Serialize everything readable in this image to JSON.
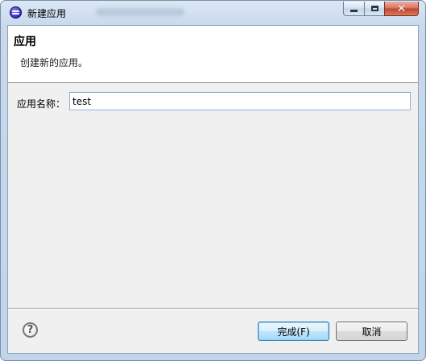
{
  "window": {
    "title": "新建应用",
    "controls": {
      "minimize_icon": "minimize-icon",
      "maximize_icon": "maximize-icon",
      "close_icon": "close-icon",
      "close_glyph": "✕"
    }
  },
  "header": {
    "title": "应用",
    "description": "创建新的应用。"
  },
  "form": {
    "name_label": "应用名称：",
    "name_value": "test"
  },
  "footer": {
    "help_icon": "help-icon",
    "help_glyph": "?",
    "finish_label": "完成(F)",
    "cancel_label": "取消"
  },
  "colors": {
    "window_frame": "#c2d4e8",
    "client_bg": "#f0f0f0",
    "header_bg": "#ffffff",
    "input_border": "#8fb3d9",
    "default_button": "#bee6fd",
    "close_button": "#c2412b"
  }
}
